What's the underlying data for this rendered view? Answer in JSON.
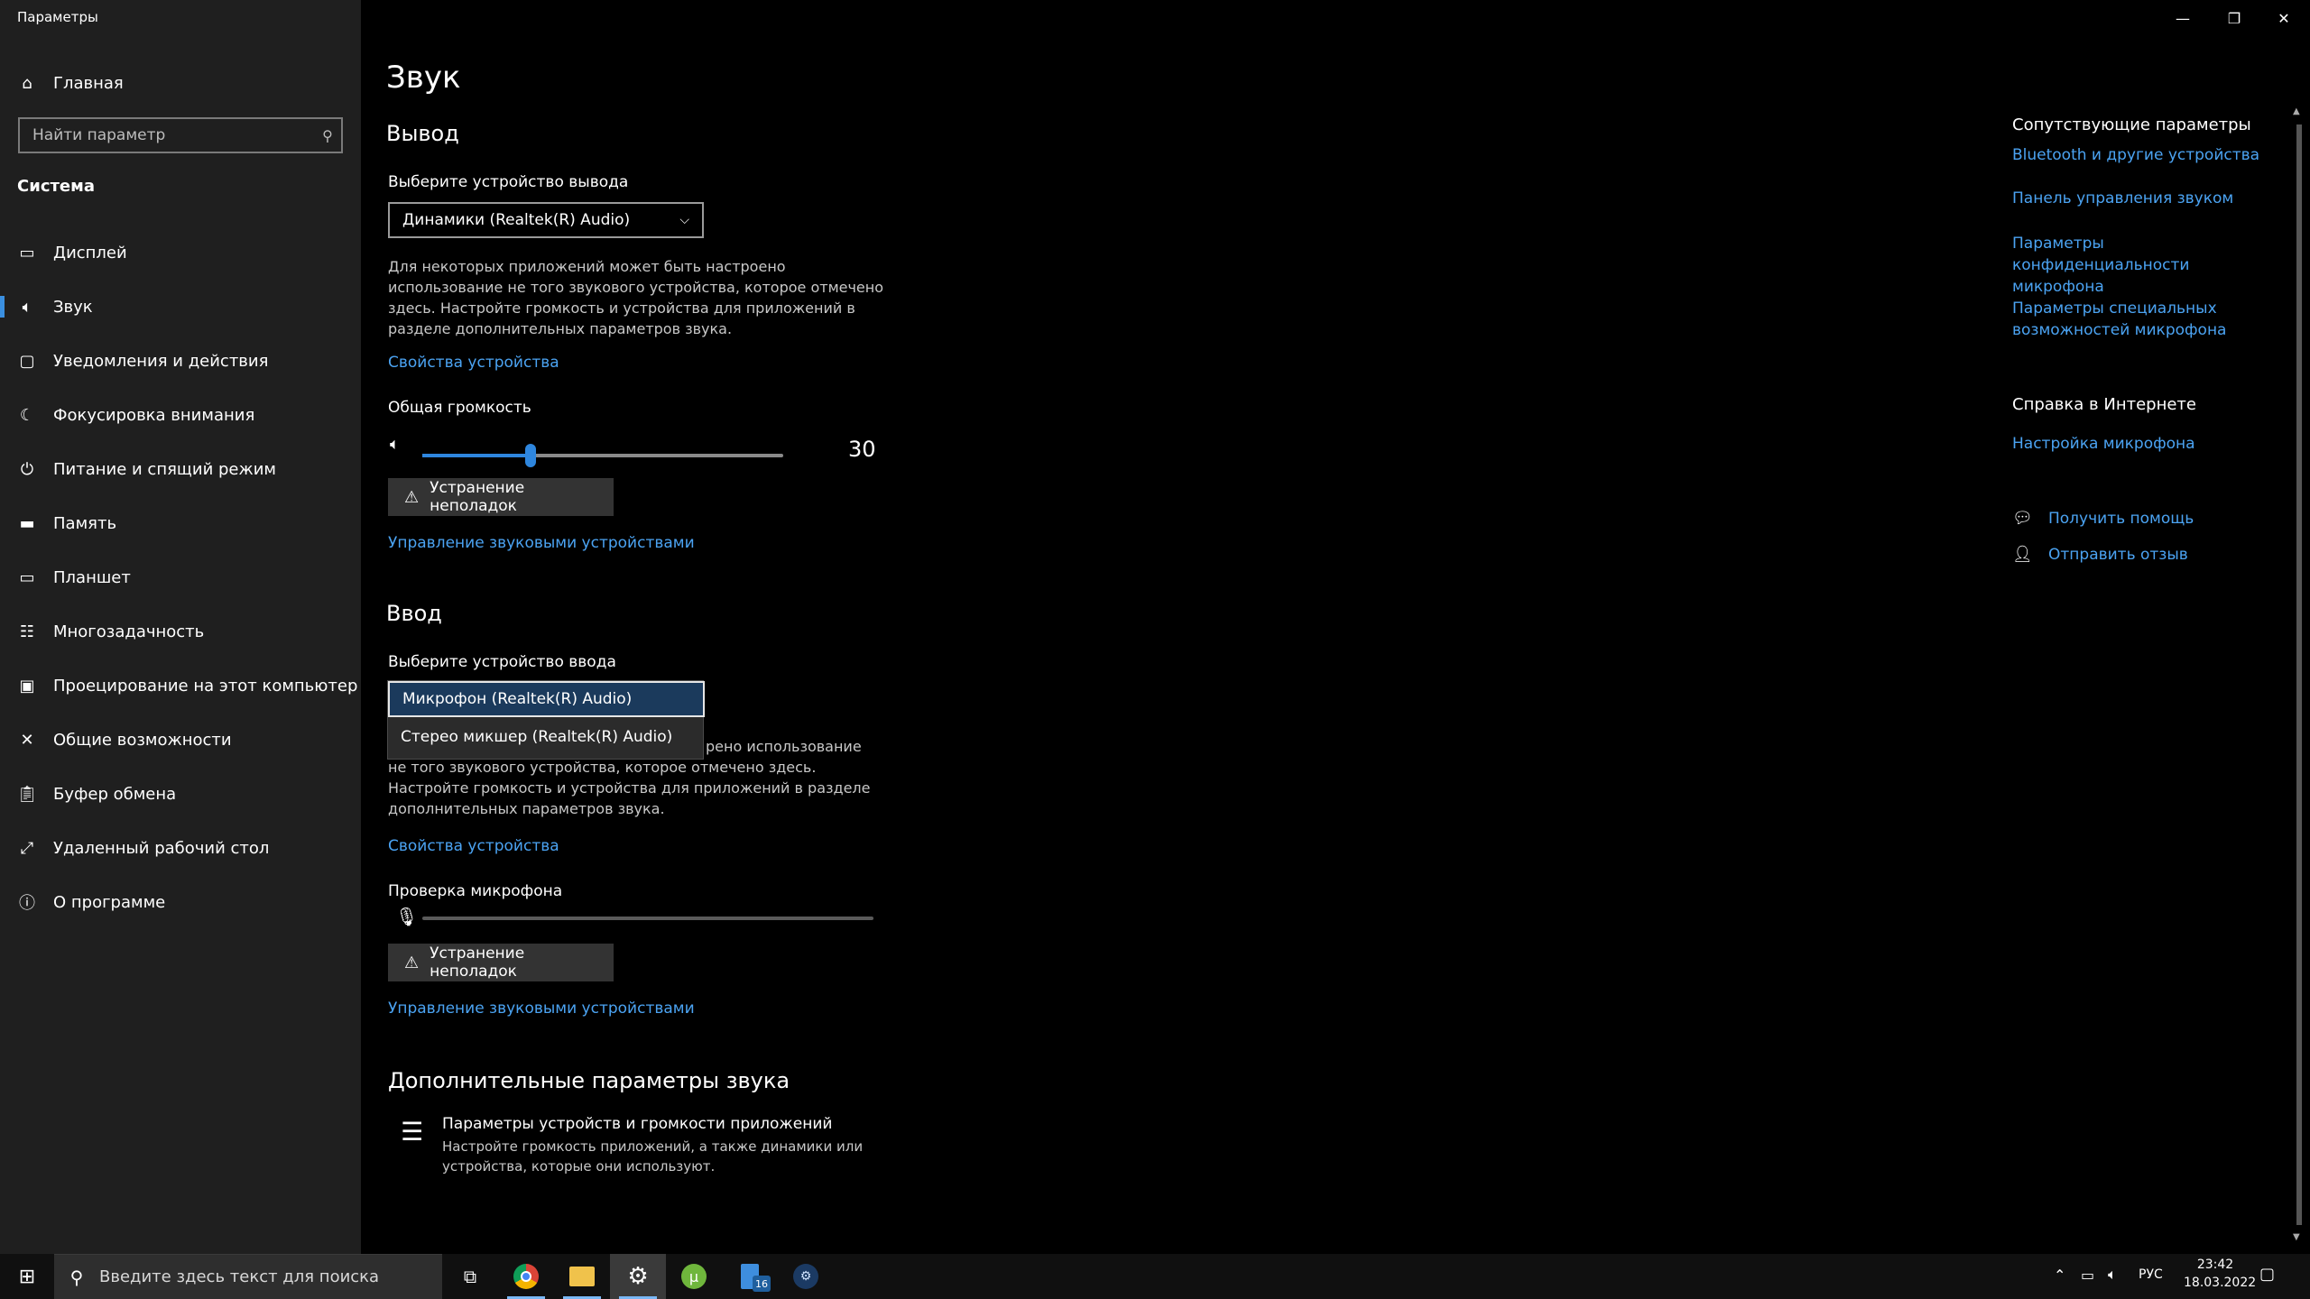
{
  "window": {
    "title": "Параметры"
  },
  "sidebar": {
    "home_label": "Главная",
    "search_placeholder": "Найти параметр",
    "section_label": "Система",
    "items": [
      {
        "label": "Дисплей",
        "icon": "display-icon"
      },
      {
        "label": "Звук",
        "icon": "speaker-icon",
        "active": true
      },
      {
        "label": "Уведомления и действия",
        "icon": "notifications-icon"
      },
      {
        "label": "Фокусировка внимания",
        "icon": "moon-icon"
      },
      {
        "label": "Питание и спящий режим",
        "icon": "power-icon"
      },
      {
        "label": "Память",
        "icon": "storage-icon"
      },
      {
        "label": "Планшет",
        "icon": "tablet-icon"
      },
      {
        "label": "Многозадачность",
        "icon": "multitasking-icon"
      },
      {
        "label": "Проецирование на этот компьютер",
        "icon": "projecting-icon"
      },
      {
        "label": "Общие возможности",
        "icon": "shared-experiences-icon"
      },
      {
        "label": "Буфер обмена",
        "icon": "clipboard-icon"
      },
      {
        "label": "Удаленный рабочий стол",
        "icon": "remote-desktop-icon"
      },
      {
        "label": "О программе",
        "icon": "info-icon"
      }
    ]
  },
  "main": {
    "title": "Звук",
    "output": {
      "heading": "Вывод",
      "device_label": "Выберите устройство вывода",
      "selected_device": "Динамики (Realtek(R) Audio)",
      "description": "Для некоторых приложений может быть настроено использование не того звукового устройства, которое отмечено здесь. Настройте громкость и устройства для приложений в разделе дополнительных параметров звука.",
      "device_properties_link": "Свойства устройства",
      "volume_label": "Общая громкость",
      "volume_value": "30",
      "volume_level": 0.3,
      "troubleshoot_label": "Устранение неполадок",
      "manage_devices_link": "Управление звуковыми устройствами"
    },
    "input": {
      "heading": "Ввод",
      "device_label": "Выберите устройство ввода",
      "options": [
        "Микрофон (Realtek(R) Audio)",
        "Стерео микшер (Realtek(R) Audio)"
      ],
      "selected_index": 0,
      "description_tail": "рено использование",
      "description_rest": "не того звукового устройства, которое отмечено здесь. Настройте громкость и устройства для приложений в разделе дополнительных параметров звука.",
      "device_properties_link": "Свойства устройства",
      "mic_test_label": "Проверка микрофона",
      "mic_level": 0,
      "troubleshoot_label": "Устранение неполадок",
      "manage_devices_link": "Управление звуковыми устройствами"
    },
    "advanced": {
      "heading": "Дополнительные параметры звука",
      "item_title": "Параметры устройств и громкости приложений",
      "item_desc_line1": "Настройте громкость приложений, а также динамики или",
      "item_desc_line2": "устройства, которые они используют."
    }
  },
  "related": {
    "heading": "Сопутствующие параметры",
    "links": [
      "Bluetooth и другие устройства",
      "Панель управления звуком",
      "Параметры конфиденциальности микрофона",
      "Параметры специальных возможностей микрофона"
    ],
    "web_help_heading": "Справка в Интернете",
    "web_help_link": "Настройка микрофона",
    "get_help": "Получить помощь",
    "feedback": "Отправить отзыв"
  },
  "taskbar": {
    "search_placeholder": "Введите здесь текст для поиска",
    "badge_count": "16",
    "lang": "РУС",
    "time": "23:42",
    "date": "18.03.2022"
  },
  "colors": {
    "accent": "#2e86de",
    "link": "#4ba3f2",
    "sidebar_bg": "#1f1f1f"
  }
}
